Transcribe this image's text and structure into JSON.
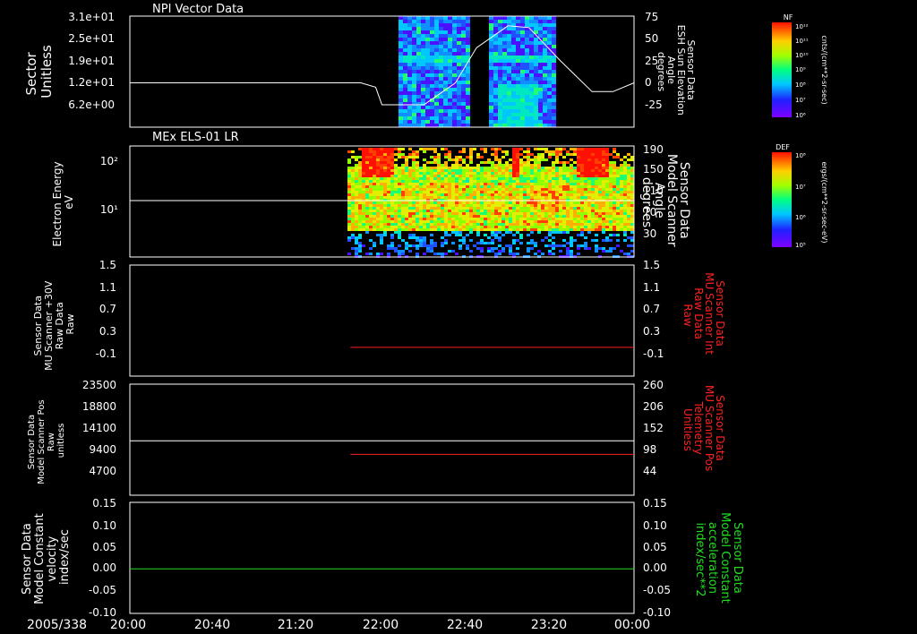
{
  "date_label": "2005/338",
  "x_ticks": [
    "20:00",
    "20:40",
    "21:20",
    "22:00",
    "22:40",
    "23:20",
    "00:00"
  ],
  "panels": [
    {
      "title": "NPI Vector Data",
      "left_label": [
        "Sector",
        "Unitless"
      ],
      "left_ticks": [
        "3.1e+01",
        "2.5e+01",
        "1.9e+01",
        "1.2e+01",
        "6.2e+00"
      ],
      "right_label": [
        "Sensor Data",
        "ESH Sun Elevation",
        "Angle",
        "degrees"
      ],
      "right_ticks": [
        "75",
        "50",
        "25",
        "0",
        "-25"
      ],
      "right_color": "#ffffff",
      "colorbar": {
        "label": "NF",
        "unit": "cnts/(cm**2-sr-sec)",
        "ticks": [
          "10¹²",
          "10¹¹",
          "10¹⁰",
          "10⁹",
          "10⁸",
          "10⁷",
          "10⁶"
        ]
      }
    },
    {
      "title": "MEx ELS-01 LR",
      "left_label": [
        "Electron Energy",
        "eV"
      ],
      "left_ticks": [
        "10²",
        "10¹"
      ],
      "right_label": [
        "Sensor Data",
        "Model Scanner",
        "Angle",
        "degrees"
      ],
      "right_ticks": [
        "190",
        "150",
        "110",
        "70",
        "30"
      ],
      "right_color": "#ffffff",
      "colorbar": {
        "label": "DEF",
        "unit": "ergs/(cm**2-sr-sec-eV)",
        "ticks": [
          "10⁸",
          "10⁷",
          "10⁶",
          "10⁵"
        ]
      }
    },
    {
      "title": "",
      "left_label": [
        "Sensor Data",
        "MU Scanner +30V",
        "Raw Data",
        "Raw"
      ],
      "left_ticks": [
        "1.5",
        "1.1",
        "0.7",
        "0.3",
        "-0.1"
      ],
      "right_label": [
        "Sensor Data",
        "MU Scanner Int",
        "Raw Data",
        "Raw"
      ],
      "right_ticks": [
        "1.5",
        "1.1",
        "0.7",
        "0.3",
        "-0.1"
      ],
      "right_color": "#ff2020"
    },
    {
      "title": "",
      "left_label": [
        "Sensor Data",
        "Model Scanner Pos",
        "Raw",
        "unitless"
      ],
      "left_ticks": [
        "23500",
        "18800",
        "14100",
        "9400",
        "4700"
      ],
      "right_label": [
        "Sensor Data",
        "MU Scanner Pos",
        "Telemetry",
        "Unitless"
      ],
      "right_ticks": [
        "260",
        "206",
        "152",
        "98",
        "44"
      ],
      "right_color": "#ff2020"
    },
    {
      "title": "",
      "left_label": [
        "Sensor Data",
        "Model Constant",
        "velocity",
        "index/sec"
      ],
      "left_ticks": [
        "0.15",
        "0.10",
        "0.05",
        "0.00",
        "-0.05",
        "-0.10"
      ],
      "right_label": [
        "Sensor Data",
        "Model Constant",
        "acceleration",
        "index/sec**2"
      ],
      "right_ticks": [
        "0.15",
        "0.10",
        "0.05",
        "0.00",
        "-0.05",
        "-0.10"
      ],
      "right_color": "#22dd22"
    }
  ],
  "chart_data": {
    "type": "line",
    "x_range": [
      "20:00",
      "00:00"
    ],
    "sun_elevation_deg": {
      "x": [
        "20:00",
        "21:50",
        "21:57",
        "22:00",
        "22:20",
        "22:35",
        "22:45",
        "23:00",
        "23:10",
        "23:25",
        "23:40",
        "23:50",
        "00:00"
      ],
      "y": [
        0,
        0,
        -5,
        -25,
        -25,
        0,
        40,
        65,
        63,
        25,
        -10,
        -10,
        0
      ]
    },
    "scanner_angle_deg": {
      "x": [
        "20:00",
        "00:00"
      ],
      "y": [
        93,
        93
      ]
    },
    "mu_scanner_int_raw": {
      "x": [
        "21:45",
        "00:00"
      ],
      "y": [
        0,
        0
      ]
    },
    "model_scanner_pos_raw": {
      "x": [
        "20:00",
        "00:00"
      ],
      "y": [
        11300,
        11300
      ]
    },
    "mu_scanner_pos_unitless": {
      "x": [
        "21:45",
        "00:00"
      ],
      "y": [
        86,
        86
      ]
    },
    "model_constant_velocity": {
      "x": [
        "20:00",
        "00:00"
      ],
      "y": [
        0,
        0
      ]
    },
    "colors": {
      "sun_elevation": "#ffffff",
      "int_raw": "#ff2020",
      "pos_unitless": "#ff2020",
      "velocity": "#22dd22"
    }
  }
}
